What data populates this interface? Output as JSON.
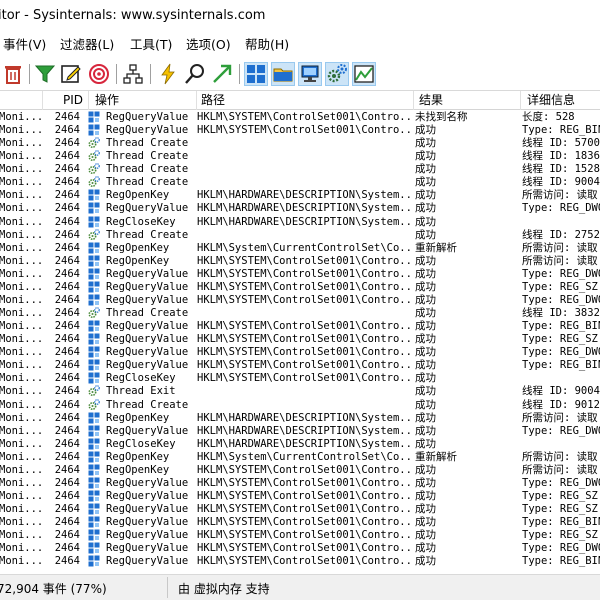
{
  "window": {
    "title": "itor - Sysinternals: www.sysinternals.com"
  },
  "menu": [
    {
      "label": "事件(V)"
    },
    {
      "label": "过滤器(L)"
    },
    {
      "label": "工具(T)"
    },
    {
      "label": "选项(O)"
    },
    {
      "label": "帮助(H)"
    }
  ],
  "toolbar": [
    {
      "icon": "delete-icon"
    },
    {
      "icon": "filter-icon"
    },
    {
      "icon": "highlight-edit-icon"
    },
    {
      "icon": "target-icon"
    },
    {
      "icon": "process-tree-icon"
    },
    {
      "icon": "lightning-icon"
    },
    {
      "icon": "find-icon"
    },
    {
      "icon": "jump-arrow-icon"
    },
    {
      "icon": "registry-activity-icon"
    },
    {
      "icon": "filesystem-activity-icon"
    },
    {
      "icon": "network-activity-icon"
    },
    {
      "icon": "process-activity-icon"
    },
    {
      "icon": "profiling-activity-icon"
    }
  ],
  "columns": {
    "pid": "PID",
    "operation": "操作",
    "path": "路径",
    "result": "结果",
    "detail": "详细信息"
  },
  "colors": {
    "registry_icon": "#1f6fcf",
    "thread_icon": "#4a8a3a",
    "highlight_blue": "#0078d7"
  },
  "rows": [
    {
      "proc": "Moni...",
      "pid": "2464",
      "type": "reg",
      "op": "RegQueryValue",
      "path": "HKLM\\SYSTEM\\ControlSet001\\Contro...",
      "result": "未找到名称",
      "detail": "长度: 528"
    },
    {
      "proc": "Moni...",
      "pid": "2464",
      "type": "reg",
      "op": "RegQueryValue",
      "path": "HKLM\\SYSTEM\\ControlSet001\\Contro...",
      "result": "成功",
      "detail": "Type: REG_BIN"
    },
    {
      "proc": "Moni...",
      "pid": "2464",
      "type": "thread",
      "op": "Thread Create",
      "path": "",
      "result": "成功",
      "detail": "线程 ID: 5700"
    },
    {
      "proc": "Moni...",
      "pid": "2464",
      "type": "thread",
      "op": "Thread Create",
      "path": "",
      "result": "成功",
      "detail": "线程 ID: 1836"
    },
    {
      "proc": "Moni...",
      "pid": "2464",
      "type": "thread",
      "op": "Thread Create",
      "path": "",
      "result": "成功",
      "detail": "线程 ID: 1528"
    },
    {
      "proc": "Moni...",
      "pid": "2464",
      "type": "thread",
      "op": "Thread Create",
      "path": "",
      "result": "成功",
      "detail": "线程 ID: 9004"
    },
    {
      "proc": "Moni...",
      "pid": "2464",
      "type": "reg",
      "op": "RegOpenKey",
      "path": "HKLM\\HARDWARE\\DESCRIPTION\\System...",
      "result": "成功",
      "detail": "所需访问: 读取"
    },
    {
      "proc": "Moni...",
      "pid": "2464",
      "type": "reg",
      "op": "RegQueryValue",
      "path": "HKLM\\HARDWARE\\DESCRIPTION\\System...",
      "result": "成功",
      "detail": "Type: REG_DWO"
    },
    {
      "proc": "Moni...",
      "pid": "2464",
      "type": "reg",
      "op": "RegCloseKey",
      "path": "HKLM\\HARDWARE\\DESCRIPTION\\System...",
      "result": "成功",
      "detail": ""
    },
    {
      "proc": "Moni...",
      "pid": "2464",
      "type": "thread",
      "op": "Thread Create",
      "path": "",
      "result": "成功",
      "detail": "线程 ID: 2752"
    },
    {
      "proc": "Moni...",
      "pid": "2464",
      "type": "reg",
      "op": "RegOpenKey",
      "path": "HKLM\\System\\CurrentControlSet\\Co...",
      "result": "重新解析",
      "detail": "所需访问: 读取"
    },
    {
      "proc": "Moni...",
      "pid": "2464",
      "type": "reg",
      "op": "RegOpenKey",
      "path": "HKLM\\SYSTEM\\ControlSet001\\Contro...",
      "result": "成功",
      "detail": "所需访问: 读取"
    },
    {
      "proc": "Moni...",
      "pid": "2464",
      "type": "reg",
      "op": "RegQueryValue",
      "path": "HKLM\\SYSTEM\\ControlSet001\\Contro...",
      "result": "成功",
      "detail": "Type: REG_DWO"
    },
    {
      "proc": "Moni...",
      "pid": "2464",
      "type": "reg",
      "op": "RegQueryValue",
      "path": "HKLM\\SYSTEM\\ControlSet001\\Contro...",
      "result": "成功",
      "detail": "Type: REG_SZ,"
    },
    {
      "proc": "Moni...",
      "pid": "2464",
      "type": "reg",
      "op": "RegQueryValue",
      "path": "HKLM\\SYSTEM\\ControlSet001\\Contro...",
      "result": "成功",
      "detail": "Type: REG_DWO"
    },
    {
      "proc": "Moni...",
      "pid": "2464",
      "type": "thread",
      "op": "Thread Create",
      "path": "",
      "result": "成功",
      "detail": "线程 ID: 3832"
    },
    {
      "proc": "Moni...",
      "pid": "2464",
      "type": "reg",
      "op": "RegQueryValue",
      "path": "HKLM\\SYSTEM\\ControlSet001\\Contro...",
      "result": "成功",
      "detail": "Type: REG_BIN"
    },
    {
      "proc": "Moni...",
      "pid": "2464",
      "type": "reg",
      "op": "RegQueryValue",
      "path": "HKLM\\SYSTEM\\ControlSet001\\Contro...",
      "result": "成功",
      "detail": "Type: REG_SZ,"
    },
    {
      "proc": "Moni...",
      "pid": "2464",
      "type": "reg",
      "op": "RegQueryValue",
      "path": "HKLM\\SYSTEM\\ControlSet001\\Contro...",
      "result": "成功",
      "detail": "Type: REG_DWO"
    },
    {
      "proc": "Moni...",
      "pid": "2464",
      "type": "reg",
      "op": "RegQueryValue",
      "path": "HKLM\\SYSTEM\\ControlSet001\\Contro...",
      "result": "成功",
      "detail": "Type: REG_BIN"
    },
    {
      "proc": "Moni...",
      "pid": "2464",
      "type": "reg",
      "op": "RegCloseKey",
      "path": "HKLM\\SYSTEM\\ControlSet001\\Contro...",
      "result": "成功",
      "detail": ""
    },
    {
      "proc": "Moni...",
      "pid": "2464",
      "type": "thread",
      "op": "Thread Exit",
      "path": "",
      "result": "成功",
      "detail": "线程 ID: 9004"
    },
    {
      "proc": "Moni...",
      "pid": "2464",
      "type": "thread",
      "op": "Thread Create",
      "path": "",
      "result": "成功",
      "detail": "线程 ID: 9012"
    },
    {
      "proc": "Moni...",
      "pid": "2464",
      "type": "reg",
      "op": "RegOpenKey",
      "path": "HKLM\\HARDWARE\\DESCRIPTION\\System...",
      "result": "成功",
      "detail": "所需访问: 读取"
    },
    {
      "proc": "Moni...",
      "pid": "2464",
      "type": "reg",
      "op": "RegQueryValue",
      "path": "HKLM\\HARDWARE\\DESCRIPTION\\System...",
      "result": "成功",
      "detail": "Type: REG_DWO"
    },
    {
      "proc": "Moni...",
      "pid": "2464",
      "type": "reg",
      "op": "RegCloseKey",
      "path": "HKLM\\HARDWARE\\DESCRIPTION\\System...",
      "result": "成功",
      "detail": ""
    },
    {
      "proc": "Moni...",
      "pid": "2464",
      "type": "reg",
      "op": "RegOpenKey",
      "path": "HKLM\\System\\CurrentControlSet\\Co...",
      "result": "重新解析",
      "detail": "所需访问: 读取"
    },
    {
      "proc": "Moni...",
      "pid": "2464",
      "type": "reg",
      "op": "RegOpenKey",
      "path": "HKLM\\SYSTEM\\ControlSet001\\Contro...",
      "result": "成功",
      "detail": "所需访问: 读取"
    },
    {
      "proc": "Moni...",
      "pid": "2464",
      "type": "reg",
      "op": "RegQueryValue",
      "path": "HKLM\\SYSTEM\\ControlSet001\\Contro...",
      "result": "成功",
      "detail": "Type: REG_DWO"
    },
    {
      "proc": "Moni...",
      "pid": "2464",
      "type": "reg",
      "op": "RegQueryValue",
      "path": "HKLM\\SYSTEM\\ControlSet001\\Contro...",
      "result": "成功",
      "detail": "Type: REG_SZ,"
    },
    {
      "proc": "Moni...",
      "pid": "2464",
      "type": "reg",
      "op": "RegQueryValue",
      "path": "HKLM\\SYSTEM\\ControlSet001\\Contro...",
      "result": "成功",
      "detail": "Type: REG_SZ,"
    },
    {
      "proc": "Moni...",
      "pid": "2464",
      "type": "reg",
      "op": "RegQueryValue",
      "path": "HKLM\\SYSTEM\\ControlSet001\\Contro...",
      "result": "成功",
      "detail": "Type: REG_BIN"
    },
    {
      "proc": "Moni...",
      "pid": "2464",
      "type": "reg",
      "op": "RegQueryValue",
      "path": "HKLM\\SYSTEM\\ControlSet001\\Contro...",
      "result": "成功",
      "detail": "Type: REG_SZ,"
    },
    {
      "proc": "Moni...",
      "pid": "2464",
      "type": "reg",
      "op": "RegQueryValue",
      "path": "HKLM\\SYSTEM\\ControlSet001\\Contro...",
      "result": "成功",
      "detail": "Type: REG_DWO"
    },
    {
      "proc": "Moni...",
      "pid": "2464",
      "type": "reg",
      "op": "RegQueryValue",
      "path": "HKLM\\SYSTEM\\ControlSet001\\Contro...",
      "result": "成功",
      "detail": "Type: REG_BIN"
    }
  ],
  "status": {
    "events": "72,904 事件 (77%)",
    "backing": "由 虚拟内存 支持"
  }
}
